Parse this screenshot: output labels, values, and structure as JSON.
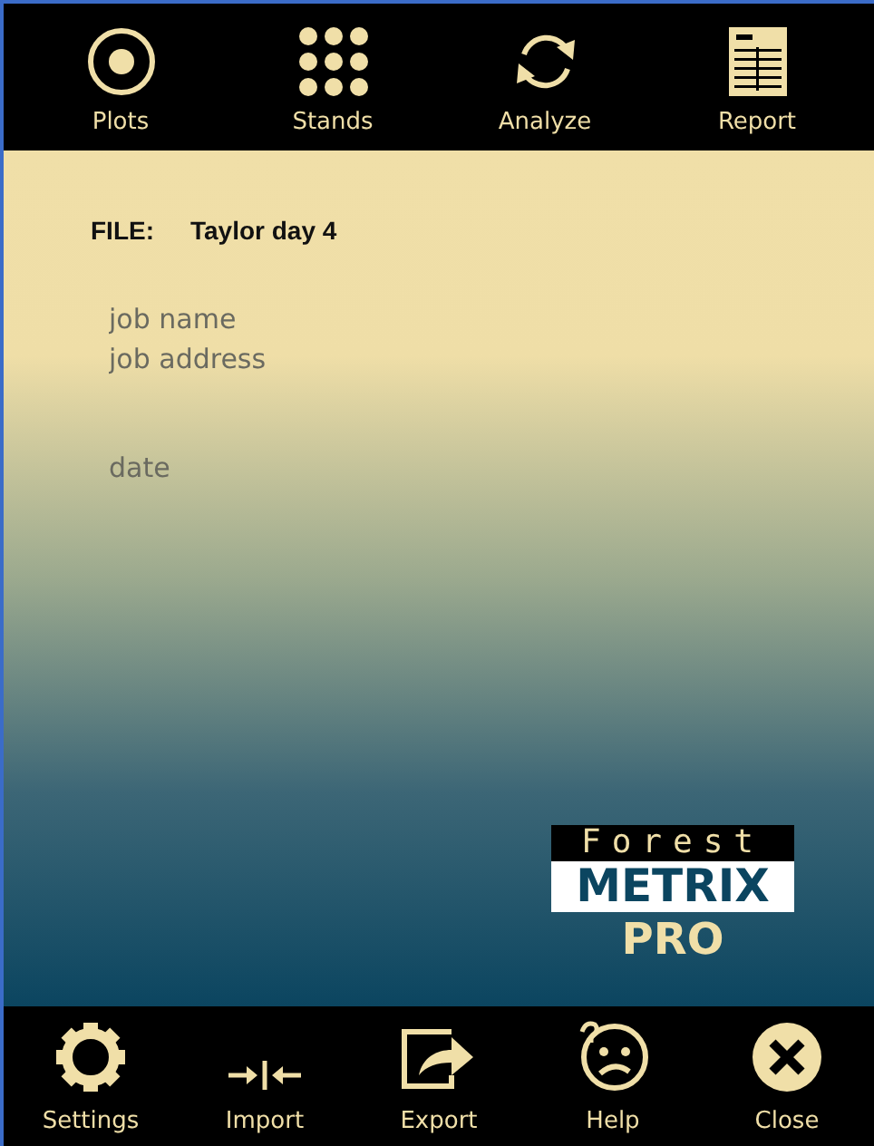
{
  "top_toolbar": [
    {
      "kind": "plots",
      "label": "Plots"
    },
    {
      "kind": "stands",
      "label": "Stands"
    },
    {
      "kind": "analyze",
      "label": "Analyze"
    },
    {
      "kind": "report",
      "label": "Report"
    }
  ],
  "file": {
    "label": "FILE:",
    "name": "Taylor day 4"
  },
  "fields": [
    {
      "placeholder": "job name"
    },
    {
      "placeholder": "job address"
    },
    {
      "placeholder": "date",
      "gap": true
    }
  ],
  "logo": {
    "top": "Forest",
    "middle": "METRIX",
    "bottom": "PRO"
  },
  "bottom_toolbar": [
    {
      "kind": "settings",
      "label": "Settings"
    },
    {
      "kind": "import",
      "label": "Import"
    },
    {
      "kind": "export",
      "label": "Export"
    },
    {
      "kind": "help",
      "label": "Help"
    },
    {
      "kind": "close",
      "label": "Close"
    }
  ]
}
